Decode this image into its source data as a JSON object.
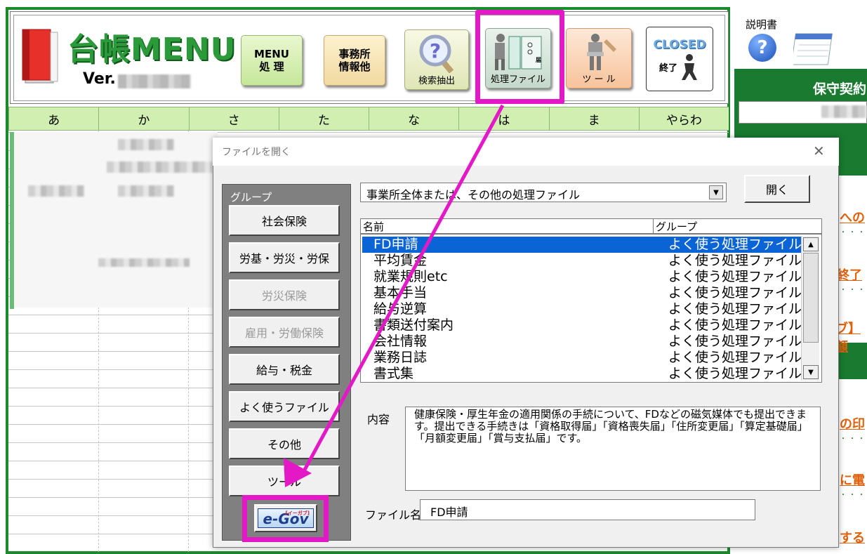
{
  "app": {
    "title": "台帳MENU",
    "version_prefix": "Ver."
  },
  "toolbar": {
    "menu_label_1": "MENU",
    "menu_label_2": "処 理",
    "office_label_1": "事務所",
    "office_label_2": "情報他",
    "search_label": "検索抽出",
    "file_label": "処理ファイル",
    "tool_label": "ツ ー ル",
    "closed_label": "CLOSED",
    "exit_label": "終了"
  },
  "kana_tabs": [
    "あ",
    "か",
    "さ",
    "た",
    "な",
    "は",
    "ま",
    "やらわ"
  ],
  "side_panel": {
    "manual_label": "説明書",
    "section_title": "保守契約",
    "links": [
      "への",
      "終了",
      "ブ】顧",
      "の印",
      "に電",
      "する"
    ]
  },
  "dialog": {
    "title": "ファイルを開く",
    "close_glyph": "✕",
    "group_heading": "グループ",
    "groups": [
      {
        "label": "社会保険",
        "enabled": true
      },
      {
        "label": "労基・労災・労保",
        "enabled": true
      },
      {
        "label": "労災保険",
        "enabled": false
      },
      {
        "label": "雇用・労働保険",
        "enabled": false
      },
      {
        "label": "給与・税金",
        "enabled": true
      },
      {
        "label": "よく使うファイル",
        "enabled": true
      },
      {
        "label": "その他",
        "enabled": true
      },
      {
        "label": "ツール",
        "enabled": true
      }
    ],
    "egov_label": "e-Gov",
    "egov_sub": "[イーガブ]",
    "category_value": "事業所全体または、その他の処理ファイル",
    "open_button": "開く",
    "list_headers": {
      "name": "名前",
      "group": "グループ"
    },
    "files": [
      {
        "name": "FD申請",
        "group": "よく使う処理ファイル",
        "selected": true
      },
      {
        "name": "平均賃金",
        "group": "よく使う処理ファイル",
        "selected": false
      },
      {
        "name": "就業規則etc",
        "group": "よく使う処理ファイル",
        "selected": false
      },
      {
        "name": "基本手当",
        "group": "よく使う処理ファイル",
        "selected": false
      },
      {
        "name": "給与逆算",
        "group": "よく使う処理ファイル",
        "selected": false
      },
      {
        "name": "書類送付案内",
        "group": "よく使う処理ファイル",
        "selected": false
      },
      {
        "name": "会社情報",
        "group": "よく使う処理ファイル",
        "selected": false
      },
      {
        "name": "業務日誌",
        "group": "よく使う処理ファイル",
        "selected": false
      },
      {
        "name": "書式集",
        "group": "よく使う処理ファイル",
        "selected": false
      }
    ],
    "content_label": "内容",
    "content_text": "健康保険・厚生年金の適用関係の手続について、FDなどの磁気媒体でも提出できます。提出できる手続きは「資格取得届」「資格喪失届」「住所変更届」「算定基礎届」「月額変更届」「賞与支払届」です。",
    "filename_label": "ファイル名",
    "filename_value": "FD申請"
  },
  "colors": {
    "brand_green": "#1a8a2a",
    "highlight_magenta": "#e418c7",
    "selection_blue": "#0a64d6"
  }
}
